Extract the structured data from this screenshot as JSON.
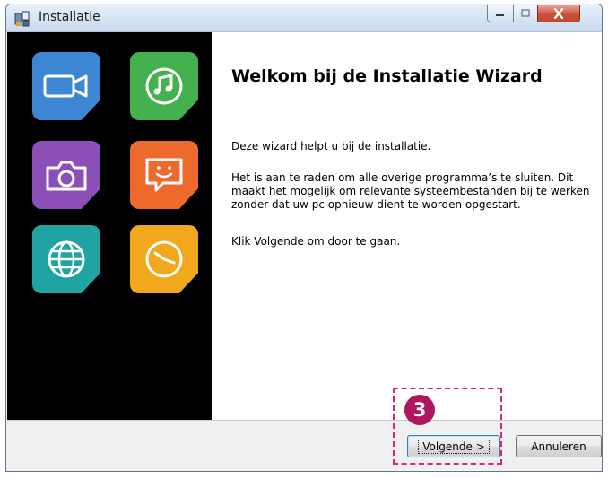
{
  "window": {
    "title": "Installatie",
    "controls": {
      "minimize": "minimize-icon",
      "maximize": "maximize-icon",
      "close": "close-icon"
    }
  },
  "sidebar": {
    "tiles": [
      {
        "icon": "video-camera-icon",
        "color": "#3d86d4"
      },
      {
        "icon": "music-note-icon",
        "color": "#43b24e"
      },
      {
        "icon": "photo-camera-icon",
        "color": "#8c4fb8"
      },
      {
        "icon": "chat-smiley-icon",
        "color": "#ee6a2c"
      },
      {
        "icon": "globe-icon",
        "color": "#1fa3a3"
      },
      {
        "icon": "clock-icon",
        "color": "#f2a81d"
      }
    ]
  },
  "content": {
    "heading": "Welkom bij de Installatie Wizard",
    "paragraph1": "Deze wizard helpt u bij de installatie.",
    "paragraph2": "Het is aan te raden om alle overige programma’s te sluiten. Dit maakt het mogelijk om relevante systeembestanden bij te werken zonder dat uw pc opnieuw dient te worden opgestart.",
    "paragraph3": "Klik Volgende om door te gaan."
  },
  "buttons": {
    "next": "Volgende >",
    "cancel": "Annuleren"
  },
  "annotation": {
    "step_number": "3",
    "color": "#d12a7d"
  }
}
